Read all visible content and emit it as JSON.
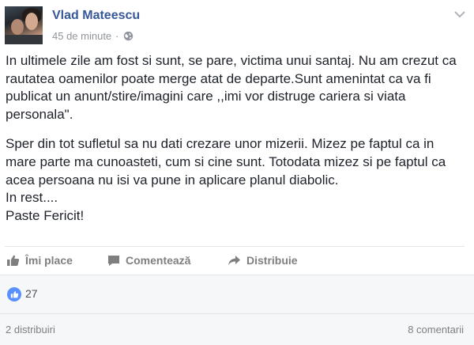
{
  "post": {
    "author": "Vlad Mateescu",
    "timestamp": "45 de minute",
    "separator": "·",
    "privacy_icon": "globe-icon",
    "paragraphs": [
      "In ultimele zile am fost si sunt, se pare, victima unui santaj. Nu am crezut ca rautatea oamenilor poate merge atat de departe.Sunt amenintat ca va fi publicat un anunt/stire/imagini care ,,imi vor distruge cariera si viata personala\".",
      "Sper din tot sufletul sa nu dati crezare unor mizerii. Mizez pe faptul ca in mare parte ma cunoasteti, cum si cine sunt. Totodata mizez si pe faptul ca acea persoana nu isi va pune in aplicare planul diabolic.\nIn rest....\nPaste Fericit!"
    ]
  },
  "actions": {
    "like_label": "Îmi place",
    "comment_label": "Comentează",
    "share_label": "Distribuie"
  },
  "stats": {
    "likes": "27",
    "shares": "2 distribuiri",
    "comments": "8 comentarii"
  },
  "colors": {
    "link_blue": "#365899",
    "like_blue": "#5890ff",
    "muted_gray": "#90949c"
  }
}
